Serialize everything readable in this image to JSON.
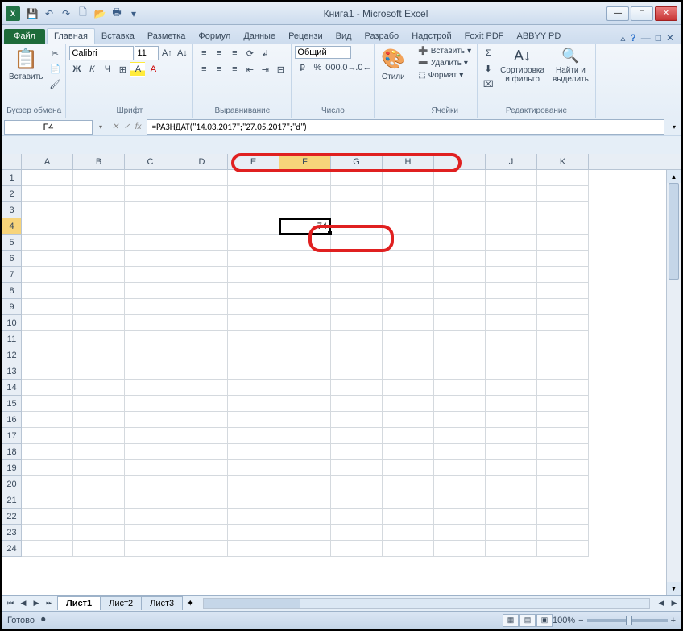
{
  "titlebar": {
    "title": "Книга1  -  Microsoft Excel"
  },
  "tabs": {
    "file": "Файл",
    "items": [
      "Главная",
      "Вставка",
      "Разметка",
      "Формул",
      "Данные",
      "Рецензи",
      "Вид",
      "Разрабо",
      "Надстрой",
      "Foxit PDF",
      "ABBYY PD"
    ],
    "active_index": 0
  },
  "ribbon": {
    "clipboard": {
      "paste": "Вставить",
      "label": "Буфер обмена"
    },
    "font": {
      "name": "Calibri",
      "size": "11",
      "label": "Шрифт"
    },
    "alignment": {
      "label": "Выравнивание"
    },
    "number": {
      "format": "Общий",
      "label": "Число"
    },
    "styles": {
      "btn": "Стили",
      "label": ""
    },
    "cells": {
      "insert": "Вставить",
      "delete": "Удалить",
      "format": "Формат",
      "label": "Ячейки"
    },
    "editing": {
      "sort": "Сортировка\nи фильтр",
      "find": "Найти и\nвыделить",
      "label": "Редактирование"
    }
  },
  "namebox": {
    "value": "F4"
  },
  "formula": {
    "value": "=РАЗНДАТ(\"14.03.2017\";\"27.05.2017\";\"d\")"
  },
  "columns": [
    "A",
    "B",
    "C",
    "D",
    "E",
    "F",
    "G",
    "H",
    "I",
    "J",
    "K"
  ],
  "rows": [
    "1",
    "2",
    "3",
    "4",
    "5",
    "6",
    "7",
    "8",
    "9",
    "10",
    "11",
    "12",
    "13",
    "14",
    "15",
    "16",
    "17",
    "18",
    "19",
    "20",
    "21",
    "22",
    "23",
    "24"
  ],
  "selected_col": "F",
  "selected_row": "4",
  "cell_value": "74",
  "sheets": {
    "items": [
      "Лист1",
      "Лист2",
      "Лист3"
    ],
    "active_index": 0
  },
  "status": {
    "ready": "Готово",
    "zoom": "100%"
  }
}
